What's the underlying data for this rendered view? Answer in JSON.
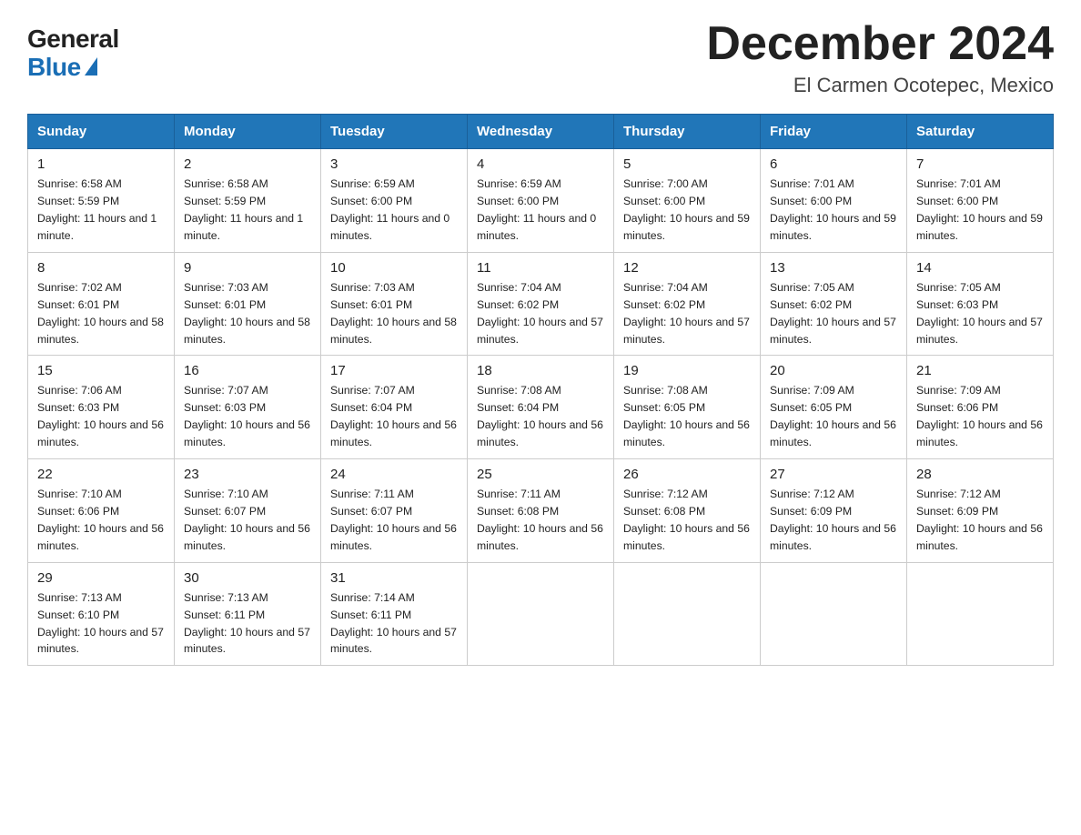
{
  "logo": {
    "general": "General",
    "blue": "Blue",
    "triangle_label": "logo-triangle"
  },
  "title": "December 2024",
  "subtitle": "El Carmen Ocotepec, Mexico",
  "days_of_week": [
    "Sunday",
    "Monday",
    "Tuesday",
    "Wednesday",
    "Thursday",
    "Friday",
    "Saturday"
  ],
  "weeks": [
    [
      {
        "day": "1",
        "sunrise": "6:58 AM",
        "sunset": "5:59 PM",
        "daylight": "11 hours and 1 minute."
      },
      {
        "day": "2",
        "sunrise": "6:58 AM",
        "sunset": "5:59 PM",
        "daylight": "11 hours and 1 minute."
      },
      {
        "day": "3",
        "sunrise": "6:59 AM",
        "sunset": "6:00 PM",
        "daylight": "11 hours and 0 minutes."
      },
      {
        "day": "4",
        "sunrise": "6:59 AM",
        "sunset": "6:00 PM",
        "daylight": "11 hours and 0 minutes."
      },
      {
        "day": "5",
        "sunrise": "7:00 AM",
        "sunset": "6:00 PM",
        "daylight": "10 hours and 59 minutes."
      },
      {
        "day": "6",
        "sunrise": "7:01 AM",
        "sunset": "6:00 PM",
        "daylight": "10 hours and 59 minutes."
      },
      {
        "day": "7",
        "sunrise": "7:01 AM",
        "sunset": "6:00 PM",
        "daylight": "10 hours and 59 minutes."
      }
    ],
    [
      {
        "day": "8",
        "sunrise": "7:02 AM",
        "sunset": "6:01 PM",
        "daylight": "10 hours and 58 minutes."
      },
      {
        "day": "9",
        "sunrise": "7:03 AM",
        "sunset": "6:01 PM",
        "daylight": "10 hours and 58 minutes."
      },
      {
        "day": "10",
        "sunrise": "7:03 AM",
        "sunset": "6:01 PM",
        "daylight": "10 hours and 58 minutes."
      },
      {
        "day": "11",
        "sunrise": "7:04 AM",
        "sunset": "6:02 PM",
        "daylight": "10 hours and 57 minutes."
      },
      {
        "day": "12",
        "sunrise": "7:04 AM",
        "sunset": "6:02 PM",
        "daylight": "10 hours and 57 minutes."
      },
      {
        "day": "13",
        "sunrise": "7:05 AM",
        "sunset": "6:02 PM",
        "daylight": "10 hours and 57 minutes."
      },
      {
        "day": "14",
        "sunrise": "7:05 AM",
        "sunset": "6:03 PM",
        "daylight": "10 hours and 57 minutes."
      }
    ],
    [
      {
        "day": "15",
        "sunrise": "7:06 AM",
        "sunset": "6:03 PM",
        "daylight": "10 hours and 56 minutes."
      },
      {
        "day": "16",
        "sunrise": "7:07 AM",
        "sunset": "6:03 PM",
        "daylight": "10 hours and 56 minutes."
      },
      {
        "day": "17",
        "sunrise": "7:07 AM",
        "sunset": "6:04 PM",
        "daylight": "10 hours and 56 minutes."
      },
      {
        "day": "18",
        "sunrise": "7:08 AM",
        "sunset": "6:04 PM",
        "daylight": "10 hours and 56 minutes."
      },
      {
        "day": "19",
        "sunrise": "7:08 AM",
        "sunset": "6:05 PM",
        "daylight": "10 hours and 56 minutes."
      },
      {
        "day": "20",
        "sunrise": "7:09 AM",
        "sunset": "6:05 PM",
        "daylight": "10 hours and 56 minutes."
      },
      {
        "day": "21",
        "sunrise": "7:09 AM",
        "sunset": "6:06 PM",
        "daylight": "10 hours and 56 minutes."
      }
    ],
    [
      {
        "day": "22",
        "sunrise": "7:10 AM",
        "sunset": "6:06 PM",
        "daylight": "10 hours and 56 minutes."
      },
      {
        "day": "23",
        "sunrise": "7:10 AM",
        "sunset": "6:07 PM",
        "daylight": "10 hours and 56 minutes."
      },
      {
        "day": "24",
        "sunrise": "7:11 AM",
        "sunset": "6:07 PM",
        "daylight": "10 hours and 56 minutes."
      },
      {
        "day": "25",
        "sunrise": "7:11 AM",
        "sunset": "6:08 PM",
        "daylight": "10 hours and 56 minutes."
      },
      {
        "day": "26",
        "sunrise": "7:12 AM",
        "sunset": "6:08 PM",
        "daylight": "10 hours and 56 minutes."
      },
      {
        "day": "27",
        "sunrise": "7:12 AM",
        "sunset": "6:09 PM",
        "daylight": "10 hours and 56 minutes."
      },
      {
        "day": "28",
        "sunrise": "7:12 AM",
        "sunset": "6:09 PM",
        "daylight": "10 hours and 56 minutes."
      }
    ],
    [
      {
        "day": "29",
        "sunrise": "7:13 AM",
        "sunset": "6:10 PM",
        "daylight": "10 hours and 57 minutes."
      },
      {
        "day": "30",
        "sunrise": "7:13 AM",
        "sunset": "6:11 PM",
        "daylight": "10 hours and 57 minutes."
      },
      {
        "day": "31",
        "sunrise": "7:14 AM",
        "sunset": "6:11 PM",
        "daylight": "10 hours and 57 minutes."
      },
      null,
      null,
      null,
      null
    ]
  ],
  "labels": {
    "sunrise_prefix": "Sunrise: ",
    "sunset_prefix": "Sunset: ",
    "daylight_prefix": "Daylight: "
  }
}
